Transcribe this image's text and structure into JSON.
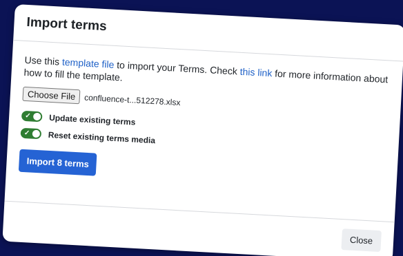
{
  "dialog": {
    "title": "Import terms",
    "intro": {
      "part1": "Use this ",
      "template_link": "template file",
      "part2": " to import your Terms. Check ",
      "info_link": "this link",
      "part3": " for more information about how to fill the template."
    },
    "file": {
      "button_label": "Choose File",
      "file_name": "confluence-t...512278.xlsx"
    },
    "toggles": [
      {
        "label": "Update existing terms",
        "checked": true
      },
      {
        "label": "Reset existing terms media",
        "checked": true
      }
    ],
    "import_button": "Import 8 terms",
    "close_button": "Close"
  },
  "colors": {
    "background": "#0b1355",
    "toggle_on": "#2f7d32",
    "primary": "#2563d4",
    "link": "#1f61c7"
  }
}
